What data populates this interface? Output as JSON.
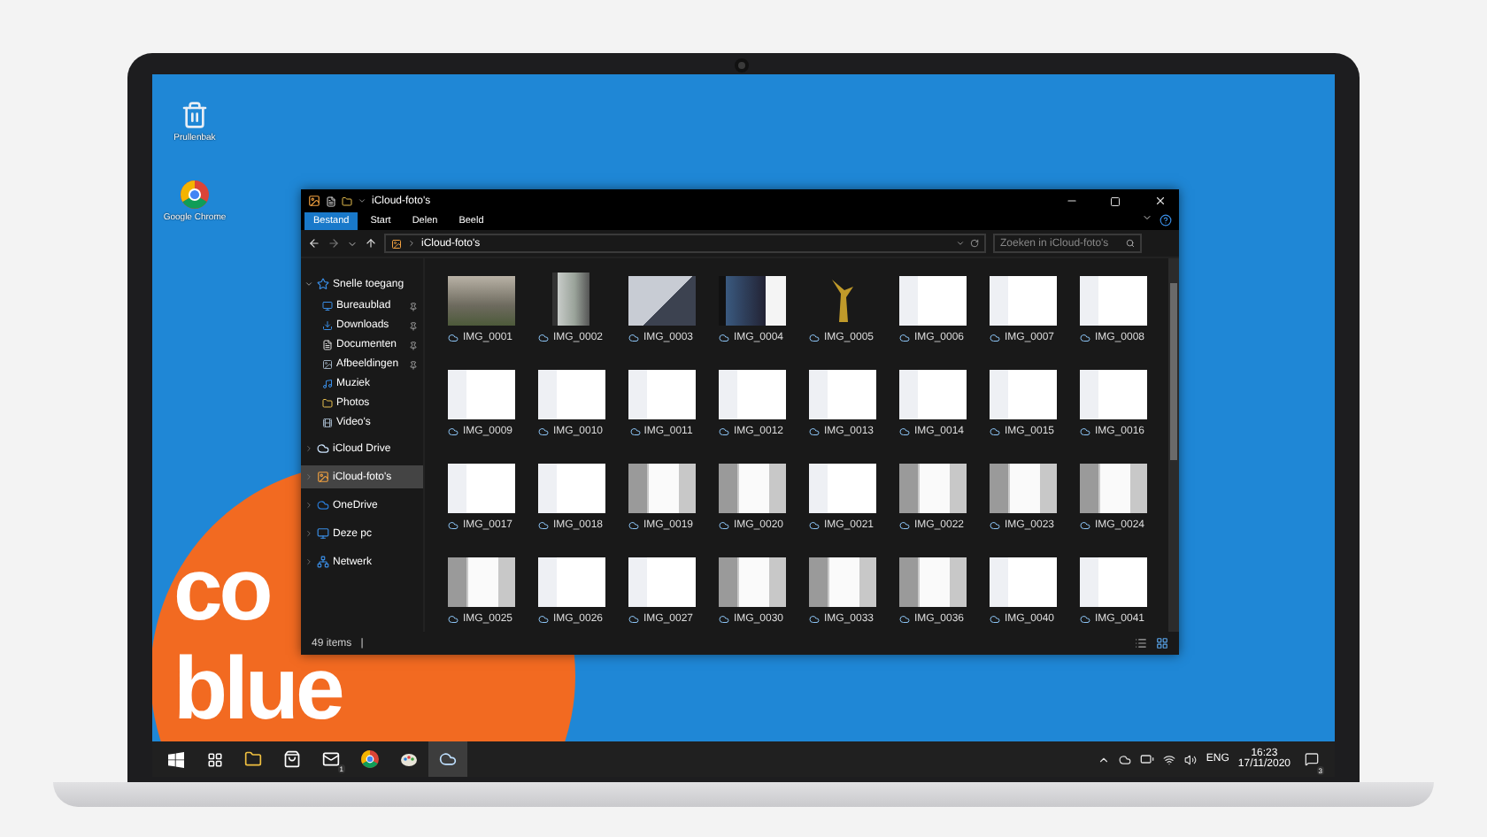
{
  "desktop_icons": [
    {
      "kind": "bin",
      "label": "Prullenbak"
    },
    {
      "kind": "chrome",
      "label": "Google Chrome"
    }
  ],
  "wallpaper_logo": {
    "line_1": "co",
    "line_2": "blue"
  },
  "window": {
    "title": "iCloud-foto's",
    "tabs": [
      {
        "label": "Bestand",
        "selected": true
      },
      {
        "label": "Start",
        "selected": false
      },
      {
        "label": "Delen",
        "selected": false
      },
      {
        "label": "Beeld",
        "selected": false
      }
    ],
    "address": "iCloud-foto's",
    "search": {
      "placeholder": "Zoeken in iCloud-foto's"
    },
    "sidebar": [
      {
        "label": "Snelle toegang",
        "kind": "star",
        "expanded": true,
        "selected": false,
        "children": [
          {
            "label": "Bureaublad",
            "kind": "desktop",
            "pinned": true
          },
          {
            "label": "Downloads",
            "kind": "download",
            "pinned": true
          },
          {
            "label": "Documenten",
            "kind": "document",
            "pinned": true
          },
          {
            "label": "Afbeeldingen",
            "kind": "image",
            "pinned": true
          },
          {
            "label": "Muziek",
            "kind": "music",
            "pinned": false
          },
          {
            "label": "Photos",
            "kind": "folder",
            "pinned": false
          },
          {
            "label": "Video's",
            "kind": "video",
            "pinned": false
          }
        ]
      },
      {
        "label": "iCloud Drive",
        "kind": "icloud",
        "expanded": false,
        "selected": false
      },
      {
        "label": "iCloud-foto's",
        "kind": "photos",
        "expanded": false,
        "selected": true
      },
      {
        "label": "OneDrive",
        "kind": "onedrive",
        "expanded": false,
        "selected": false
      },
      {
        "label": "Deze pc",
        "kind": "pc",
        "expanded": false,
        "selected": false
      },
      {
        "label": "Netwerk",
        "kind": "network",
        "expanded": false,
        "selected": false
      }
    ],
    "files": [
      {
        "name": "IMG_0001",
        "kind": "photo"
      },
      {
        "name": "IMG_0002",
        "kind": "portrait"
      },
      {
        "name": "IMG_0003",
        "kind": "tablet"
      },
      {
        "name": "IMG_0004",
        "kind": "dark"
      },
      {
        "name": "IMG_0005",
        "kind": "figure"
      },
      {
        "name": "IMG_0006",
        "kind": "screenshot"
      },
      {
        "name": "IMG_0007",
        "kind": "screenshot"
      },
      {
        "name": "IMG_0008",
        "kind": "screenshot"
      },
      {
        "name": "IMG_0009",
        "kind": "screenshot"
      },
      {
        "name": "IMG_0010",
        "kind": "screenshot"
      },
      {
        "name": "IMG_0011",
        "kind": "screenshot"
      },
      {
        "name": "IMG_0012",
        "kind": "screenshot"
      },
      {
        "name": "IMG_0013",
        "kind": "screenshot"
      },
      {
        "name": "IMG_0014",
        "kind": "screenshot"
      },
      {
        "name": "IMG_0015",
        "kind": "screenshot"
      },
      {
        "name": "IMG_0016",
        "kind": "screenshot"
      },
      {
        "name": "IMG_0017",
        "kind": "screenshot"
      },
      {
        "name": "IMG_0018",
        "kind": "screenshot"
      },
      {
        "name": "IMG_0019",
        "kind": "dialog"
      },
      {
        "name": "IMG_0020",
        "kind": "dialog"
      },
      {
        "name": "IMG_0021",
        "kind": "screenshot"
      },
      {
        "name": "IMG_0022",
        "kind": "dialog"
      },
      {
        "name": "IMG_0023",
        "kind": "dialog"
      },
      {
        "name": "IMG_0024",
        "kind": "dialog"
      },
      {
        "name": "IMG_0025",
        "kind": "dialog"
      },
      {
        "name": "IMG_0026",
        "kind": "screenshot"
      },
      {
        "name": "IMG_0027",
        "kind": "screenshot"
      },
      {
        "name": "IMG_0030",
        "kind": "dialog"
      },
      {
        "name": "IMG_0033",
        "kind": "dialog"
      },
      {
        "name": "IMG_0036",
        "kind": "dialog"
      },
      {
        "name": "IMG_0040",
        "kind": "screenshot"
      },
      {
        "name": "IMG_0041",
        "kind": "screenshot"
      }
    ],
    "status": {
      "count": "49 items",
      "separator": "|"
    }
  },
  "taskbar": {
    "apps": [
      {
        "kind": "start",
        "active": false
      },
      {
        "kind": "taskview",
        "active": false
      },
      {
        "kind": "explorer",
        "active": false
      },
      {
        "kind": "store",
        "active": false
      },
      {
        "kind": "mail",
        "active": false,
        "badge": "1"
      },
      {
        "kind": "chrome",
        "active": false
      },
      {
        "kind": "paint",
        "active": false
      },
      {
        "kind": "icloud",
        "active": true
      }
    ],
    "language": "ENG",
    "time": "16:23",
    "date": "17/11/2020",
    "notifications": "3"
  }
}
